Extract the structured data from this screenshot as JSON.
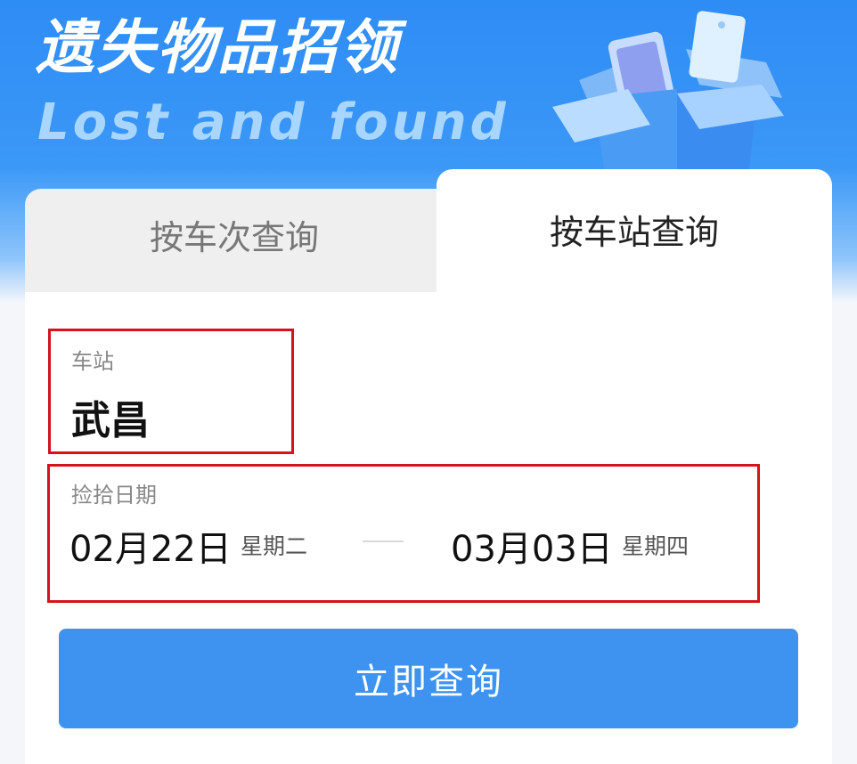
{
  "header": {
    "title": "遗失物品招领",
    "subtitle": "Lost and found"
  },
  "tabs": [
    {
      "label": "按车次查询",
      "active": false
    },
    {
      "label": "按车站查询",
      "active": true
    }
  ],
  "form": {
    "station_label": "车站",
    "station_value": "武昌",
    "date_label": "捡拾日期",
    "start_date": "02月22日",
    "start_weekday": "星期二",
    "end_date": "03月03日",
    "end_weekday": "星期四"
  },
  "submit_label": "立即查询",
  "colors": {
    "brand_blue": "#2e8cf5",
    "button": "#3e93f0",
    "highlight_border": "#d4141b"
  },
  "icons": [
    "open-box-icon",
    "phone-icon",
    "tag-icon"
  ]
}
